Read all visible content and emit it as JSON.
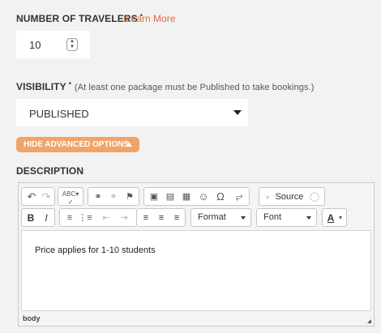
{
  "travelers": {
    "label": "NUMBER OF TRAVELERS",
    "required_mark": "*",
    "link": "Learn More",
    "value": "10"
  },
  "visibility": {
    "label": "VISIBILITY",
    "required_mark": "*",
    "hint": "(At least one package must be Published to take bookings.)",
    "selected": "PUBLISHED"
  },
  "advanced_toggle": "HIDE ADVANCED OPTIONS",
  "description": {
    "label": "DESCRIPTION",
    "format_label": "Format",
    "font_label": "Font",
    "source_label": "Source",
    "content": "Price applies for 1-10 students",
    "element_path": "body"
  },
  "colors": {
    "accent": "#e8683a",
    "button_bg": "#f1a46a"
  }
}
